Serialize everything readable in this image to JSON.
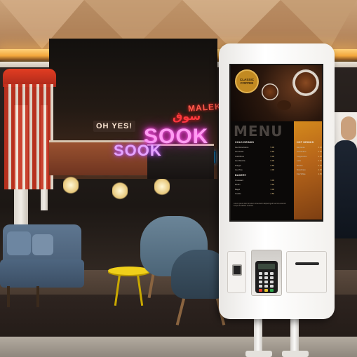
{
  "scene": {
    "description_free": true,
    "signs": {
      "oh_yes": "OH YES!",
      "sook_big": "SOOK",
      "sook_small": "SOOK",
      "arabic": "سوق",
      "malek": "MALEK!"
    }
  },
  "kiosk": {
    "logo_line1": "CLASSIC",
    "logo_line2": "COFFEE",
    "menu_title": "MENU",
    "left_column": {
      "heading": "COLD DRINKS",
      "items": [
        {
          "name": "Iced Americano",
          "price": "5.00"
        },
        {
          "name": "Iced Latte",
          "price": "5.50"
        },
        {
          "name": "Cold Brew",
          "price": "5.00"
        },
        {
          "name": "Iced Mocha",
          "price": "6.00"
        },
        {
          "name": "Frappe",
          "price": "6.50"
        },
        {
          "name": "Iced Tea",
          "price": "4.00"
        }
      ],
      "heading2": "BAKERY",
      "items2": [
        {
          "name": "Croissant",
          "price": "3.00"
        },
        {
          "name": "Muffin",
          "price": "3.50"
        },
        {
          "name": "Bagel",
          "price": "3.00"
        },
        {
          "name": "Cookie",
          "price": "2.50"
        }
      ]
    },
    "right_column": {
      "heading": "HOT DRINKS",
      "items": [
        {
          "name": "Espresso",
          "price": "3.00"
        },
        {
          "name": "Americano",
          "price": "3.50"
        },
        {
          "name": "Cappuccino",
          "price": "4.50"
        },
        {
          "name": "Latte",
          "price": "4.50"
        },
        {
          "name": "Mocha",
          "price": "5.00"
        },
        {
          "name": "Macchiato",
          "price": "4.00"
        },
        {
          "name": "Flat White",
          "price": "4.50"
        }
      ]
    },
    "footer_text": "Lorem ipsum dolor sit amet consectetur adipiscing elit sed do eiusmod tempor incididunt ut labore",
    "colors": {
      "kiosk_body": "#ffffff",
      "screen_bg": "#0b0908",
      "accent_gold": "#c28a22",
      "neon_pink": "#ff5ef0",
      "neon_red": "#ff1a1a",
      "chair_blue": "#4b6477",
      "table_yellow": "#f0d01a"
    },
    "icons": [
      "coffee-logo-icon",
      "camera-icon",
      "pinpad-icon",
      "receipt-slot-icon"
    ]
  }
}
